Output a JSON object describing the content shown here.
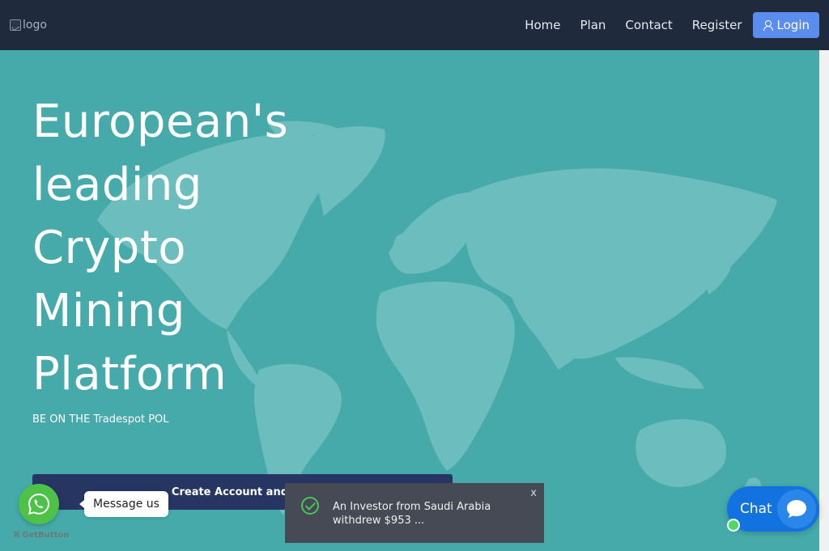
{
  "navbar": {
    "logo_alt": "logo",
    "links": [
      "Home",
      "Plan",
      "Contact",
      "Register"
    ],
    "login_label": "Login"
  },
  "hero": {
    "headline_lines": [
      "European's",
      "leading",
      "Crypto",
      "Mining",
      "Platform"
    ],
    "tagline": "BE ON THE Tradespot POL",
    "cta_label": "Create Account and Log"
  },
  "whatsapp": {
    "bubble_text": "Message us",
    "branding": "GetButton"
  },
  "toast": {
    "message": "An Investor from Saudi Arabia withdrew $953 ...",
    "close_label": "x"
  },
  "chat": {
    "label": "Chat"
  },
  "colors": {
    "navbar_bg": "#1f2a3d",
    "hero_bg": "#46aaaa",
    "map_fill": "#6cbdbd",
    "login_bg": "#5b8def",
    "cta_bg": "#273563",
    "whatsapp": "#4dc247",
    "toast_bg": "#454a54",
    "chat_bg": "#1273e0"
  }
}
